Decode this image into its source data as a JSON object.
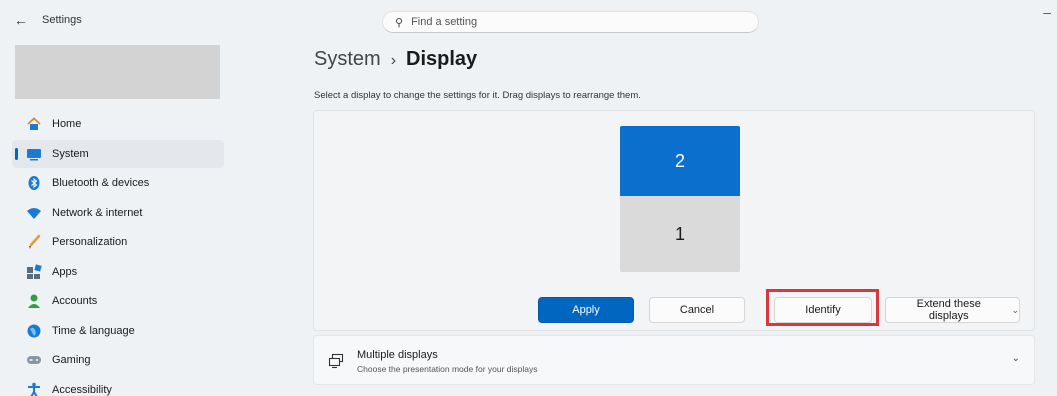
{
  "titlebar": {
    "back_glyph": "←",
    "app_title": "Settings",
    "minimize_glyph": "–"
  },
  "search": {
    "icon_glyph": "⚲",
    "placeholder": "Find a setting"
  },
  "sidebar": {
    "items": [
      {
        "label": "Home",
        "icon": "home-icon",
        "active": false
      },
      {
        "label": "System",
        "icon": "system-icon",
        "active": true
      },
      {
        "label": "Bluetooth & devices",
        "icon": "bluetooth-icon",
        "active": false
      },
      {
        "label": "Network & internet",
        "icon": "wifi-icon",
        "active": false
      },
      {
        "label": "Personalization",
        "icon": "brush-icon",
        "active": false
      },
      {
        "label": "Apps",
        "icon": "apps-icon",
        "active": false
      },
      {
        "label": "Accounts",
        "icon": "accounts-icon",
        "active": false
      },
      {
        "label": "Time & language",
        "icon": "globe-icon",
        "active": false
      },
      {
        "label": "Gaming",
        "icon": "gamepad-icon",
        "active": false
      },
      {
        "label": "Accessibility",
        "icon": "accessibility-icon",
        "active": false
      }
    ]
  },
  "header": {
    "parent": "System",
    "separator": "›",
    "current": "Display",
    "instruction": "Select a display to change the settings for it. Drag displays to rearrange them."
  },
  "displays": {
    "monitor_2": "2",
    "monitor_1": "1",
    "selected": "2"
  },
  "buttons": {
    "apply": "Apply",
    "cancel": "Cancel",
    "identify": "Identify",
    "extend": "Extend these displays",
    "extend_chevron": "⌄"
  },
  "multiple_displays": {
    "title": "Multiple displays",
    "subtitle": "Choose the presentation mode for your displays",
    "chevron": "⌄"
  },
  "colors": {
    "accent": "#0067c0",
    "selected_monitor": "#0a6fcd",
    "highlight": "#d9363e"
  }
}
